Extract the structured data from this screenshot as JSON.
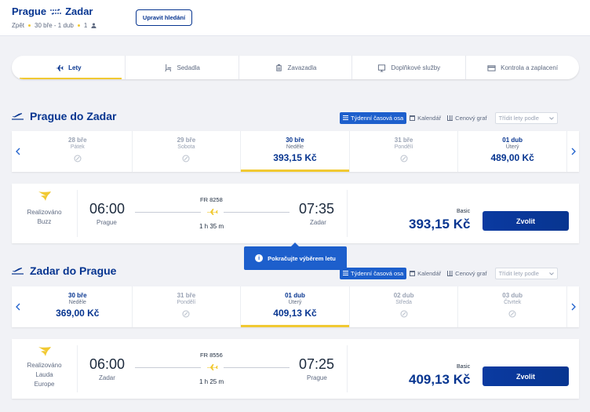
{
  "header": {
    "origin": "Prague",
    "destination": "Zadar",
    "trip_type": "Zpět",
    "dates": "30 bře - 1 dub",
    "passengers": "1",
    "edit_label": "Upravit hledání"
  },
  "stepper": [
    {
      "label": "Lety",
      "icon": "plane-icon",
      "active": true
    },
    {
      "label": "Sedadla",
      "icon": "seat-icon",
      "active": false
    },
    {
      "label": "Zavazadla",
      "icon": "luggage-icon",
      "active": false
    },
    {
      "label": "Doplňkové služby",
      "icon": "services-icon",
      "active": false
    },
    {
      "label": "Kontrola a zaplacení",
      "icon": "card-icon",
      "active": false
    }
  ],
  "views": {
    "weekly": "Týdenní časová osa",
    "calendar": "Kalendář",
    "price_graph": "Cenový graf",
    "sort_placeholder": "Třídit lety podle"
  },
  "outbound": {
    "title": "Prague do Zadar",
    "dates": [
      {
        "date": "28 bře",
        "day": "Pátek",
        "price": null
      },
      {
        "date": "29 bře",
        "day": "Sobota",
        "price": null
      },
      {
        "date": "30 bře",
        "day": "Neděle",
        "price": "393,15 Kč",
        "selected": true
      },
      {
        "date": "31 bře",
        "day": "Pondělí",
        "price": null
      },
      {
        "date": "01 dub",
        "day": "Úterý",
        "price": "489,00 Kč"
      }
    ],
    "flight": {
      "operated_by": [
        "Realizováno",
        "Buzz"
      ],
      "depart_time": "06:00",
      "depart_city": "Prague",
      "flight_number": "FR 8258",
      "duration": "1 h 35 m",
      "arrive_time": "07:35",
      "arrive_city": "Zadar",
      "fare": "Basic",
      "price": "393,15 Kč",
      "select_label": "Zvolit"
    }
  },
  "tooltip": "Pokračujte výběrem letu",
  "inbound": {
    "title": "Zadar do Prague",
    "dates": [
      {
        "date": "30 bře",
        "day": "Neděle",
        "price": "369,00 Kč"
      },
      {
        "date": "31 bře",
        "day": "Pondělí",
        "price": null
      },
      {
        "date": "01 dub",
        "day": "Úterý",
        "price": "409,13 Kč",
        "selected": true
      },
      {
        "date": "02 dub",
        "day": "Středa",
        "price": null
      },
      {
        "date": "03 dub",
        "day": "Čtvrtek",
        "price": null
      }
    ],
    "flight": {
      "operated_by": [
        "Realizováno",
        "Lauda",
        "Europe"
      ],
      "depart_time": "06:00",
      "depart_city": "Zadar",
      "flight_number": "FR 8556",
      "duration": "1 h 25 m",
      "arrive_time": "07:25",
      "arrive_city": "Prague",
      "fare": "Basic",
      "price": "409,13 Kč",
      "select_label": "Zvolit"
    }
  },
  "colors": {
    "brand": "#073590",
    "accent": "#f1c933",
    "highlight": "#1d5fcc"
  }
}
